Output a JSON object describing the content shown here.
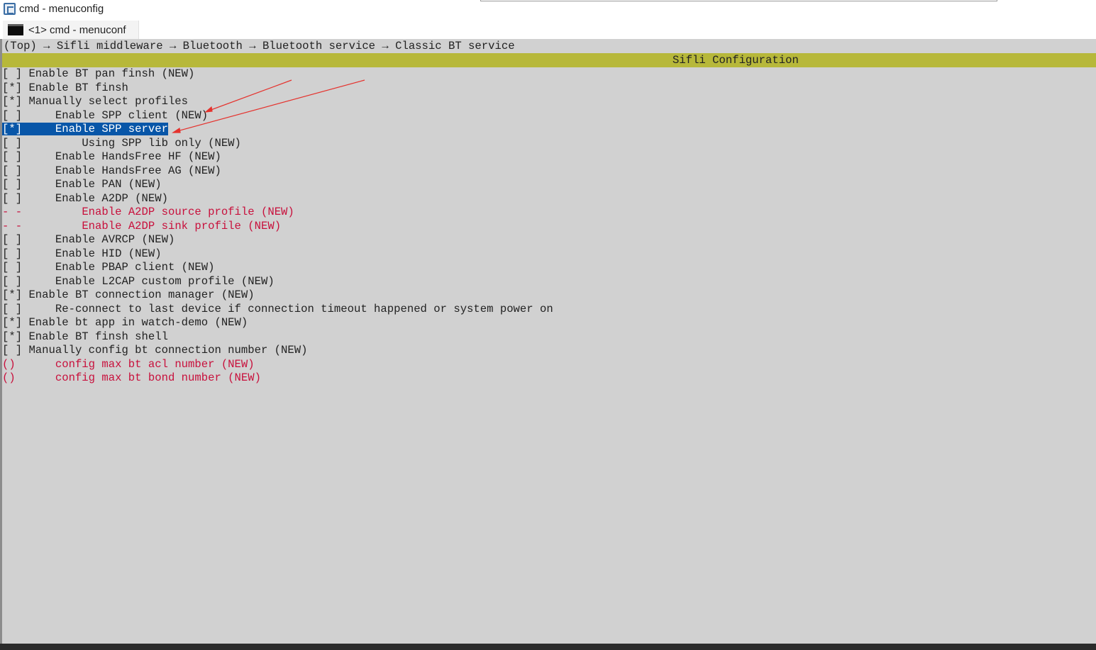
{
  "window": {
    "title": "cmd - menuconfig"
  },
  "tab": {
    "label": "<1> cmd - menuconf"
  },
  "breadcrumb": "(Top) → Sifli middleware → Bluetooth → Bluetooth service → Classic BT service",
  "config_title": "Sifli Configuration",
  "menu": {
    "rows": [
      {
        "mark": "[ ]",
        "indent": "",
        "text": "Enable BT pan finsh (NEW)"
      },
      {
        "mark": "[*]",
        "indent": "",
        "text": "Enable BT finsh"
      },
      {
        "mark": "[*]",
        "indent": "",
        "text": "Manually select profiles"
      },
      {
        "mark": "[ ]",
        "indent": "    ",
        "text": "Enable SPP client (NEW)"
      },
      {
        "mark": "[*]",
        "indent": "    ",
        "text": "Enable SPP server"
      },
      {
        "mark": "[ ]",
        "indent": "        ",
        "text": "Using SPP lib only (NEW)"
      },
      {
        "mark": "[ ]",
        "indent": "    ",
        "text": "Enable HandsFree HF (NEW)"
      },
      {
        "mark": "[ ]",
        "indent": "    ",
        "text": "Enable HandsFree AG (NEW)"
      },
      {
        "mark": "[ ]",
        "indent": "    ",
        "text": "Enable PAN (NEW)"
      },
      {
        "mark": "[ ]",
        "indent": "    ",
        "text": "Enable A2DP (NEW)"
      },
      {
        "mark": "- -",
        "indent": "        ",
        "text": "Enable A2DP source profile (NEW)"
      },
      {
        "mark": "- -",
        "indent": "        ",
        "text": "Enable A2DP sink profile (NEW)"
      },
      {
        "mark": "[ ]",
        "indent": "    ",
        "text": "Enable AVRCP (NEW)"
      },
      {
        "mark": "[ ]",
        "indent": "    ",
        "text": "Enable HID (NEW)"
      },
      {
        "mark": "[ ]",
        "indent": "    ",
        "text": "Enable PBAP client (NEW)"
      },
      {
        "mark": "[ ]",
        "indent": "    ",
        "text": "Enable L2CAP custom profile (NEW)"
      },
      {
        "mark": "[*]",
        "indent": "",
        "text": "Enable BT connection manager (NEW)"
      },
      {
        "mark": "[ ]",
        "indent": "    ",
        "text": "Re-connect to last device if connection timeout happened or system power on"
      },
      {
        "mark": "[*]",
        "indent": "",
        "text": "Enable bt app in watch-demo (NEW)"
      },
      {
        "mark": "[*]",
        "indent": "",
        "text": "Enable BT finsh shell"
      },
      {
        "mark": "[ ]",
        "indent": "",
        "text": "Manually config bt connection number (NEW)"
      },
      {
        "mark": "()",
        "indent": "     ",
        "text": "config max bt acl number (NEW)"
      },
      {
        "mark": "()",
        "indent": "     ",
        "text": "config max bt bond number (NEW)"
      }
    ]
  },
  "colors": {
    "terminal_bg": "#d1d1d1",
    "title_bar": "#b7b83a",
    "selection": "#0856a8",
    "disabled_text": "#c8103c",
    "annotation_arrow": "#e5322d"
  },
  "icons": {
    "app": "console-app-icon",
    "tab": "terminal-icon"
  }
}
